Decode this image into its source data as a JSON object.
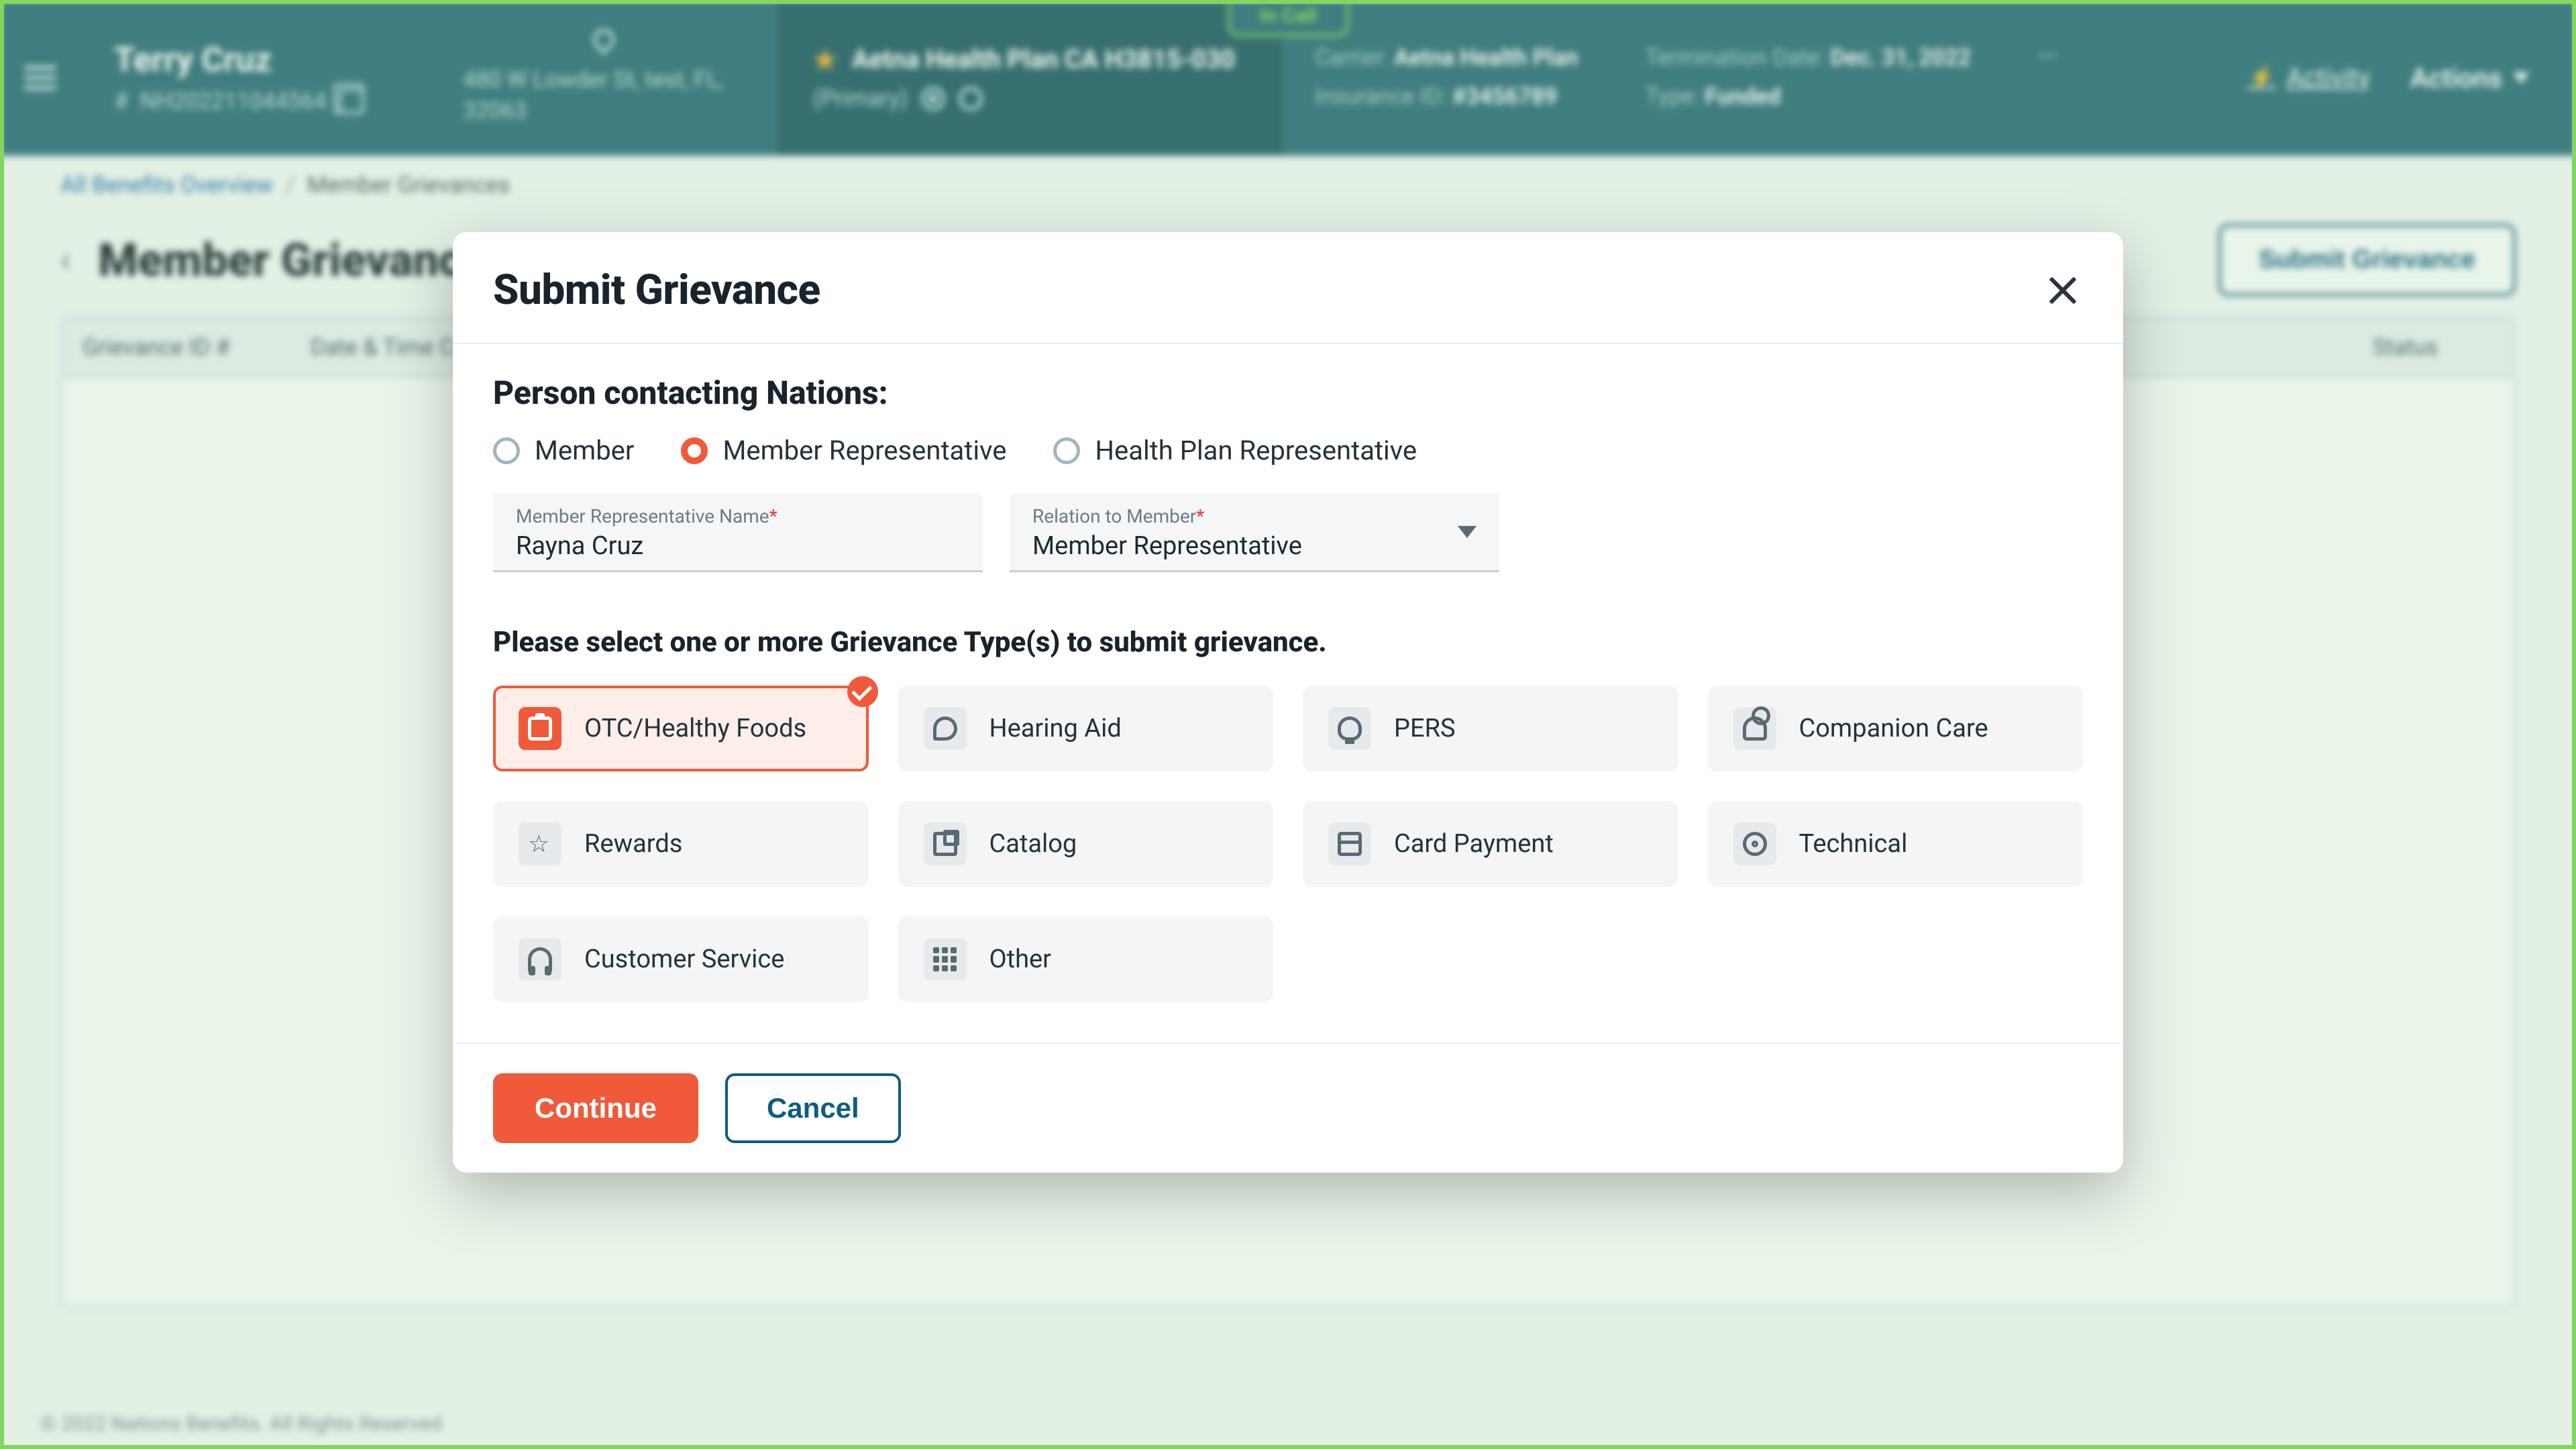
{
  "in_call_tab": "In Call",
  "topbar": {
    "patient_name": "Terry Cruz",
    "patient_id_prefix": "# ",
    "patient_id": "NH202211044564",
    "address": "480 W Lowder St, test, FL, 32063",
    "plan_name": "Aetna Health Plan CA H3815-030",
    "plan_tag": "(Primary)",
    "kv": {
      "carrier_label": "Carrier:",
      "carrier_value": "Aetna Health Plan",
      "insurance_id_label": "Insurance ID:",
      "insurance_id_value": "#3456789",
      "term_label": "Termination Date:",
      "term_value": "Dec. 31, 2022",
      "type_label": "Type:",
      "type_value": "Funded"
    },
    "ellipsis": "…",
    "activity_link": "Activity",
    "actions_label": "Actions"
  },
  "breadcrumbs": {
    "root": "All Benefits Overview",
    "current": "Member Grievances"
  },
  "page": {
    "title": "Member Grievances",
    "submit_label": "Submit Grievance",
    "columns": {
      "id": "Grievance ID #",
      "date": "Date & Time Created",
      "status": "Status"
    }
  },
  "footer": "© 2022 Nations Benefits. All Rights Reserved",
  "modal": {
    "title": "Submit Grievance",
    "section_title": "Person contacting Nations:",
    "radios": {
      "member": "Member",
      "member_rep": "Member Representative",
      "health_plan_rep": "Health Plan Representative",
      "selected": "member_rep"
    },
    "fields": {
      "rep_name_label": "Member Representative Name",
      "rep_name_value": "Rayna Cruz",
      "relation_label": "Relation to Member",
      "relation_value": "Member Representative"
    },
    "instruction": "Please select one or more Grievance Type(s) to submit grievance.",
    "types": [
      {
        "key": "otc",
        "label": "OTC/Healthy Foods",
        "icon": "jar",
        "selected": true
      },
      {
        "key": "hearing",
        "label": "Hearing Aid",
        "icon": "ear",
        "selected": false
      },
      {
        "key": "pers",
        "label": "PERS",
        "icon": "bulb",
        "selected": false
      },
      {
        "key": "companion",
        "label": "Companion Care",
        "icon": "people",
        "selected": false
      },
      {
        "key": "rewards",
        "label": "Rewards",
        "icon": "star5",
        "selected": false
      },
      {
        "key": "catalog",
        "label": "Catalog",
        "icon": "book",
        "selected": false
      },
      {
        "key": "card",
        "label": "Card Payment",
        "icon": "card",
        "selected": false
      },
      {
        "key": "technical",
        "label": "Technical",
        "icon": "gear",
        "selected": false
      },
      {
        "key": "cs",
        "label": "Customer Service",
        "icon": "headset",
        "selected": false
      },
      {
        "key": "other",
        "label": "Other",
        "icon": "dots",
        "selected": false
      }
    ],
    "continue_label": "Continue",
    "cancel_label": "Cancel"
  }
}
